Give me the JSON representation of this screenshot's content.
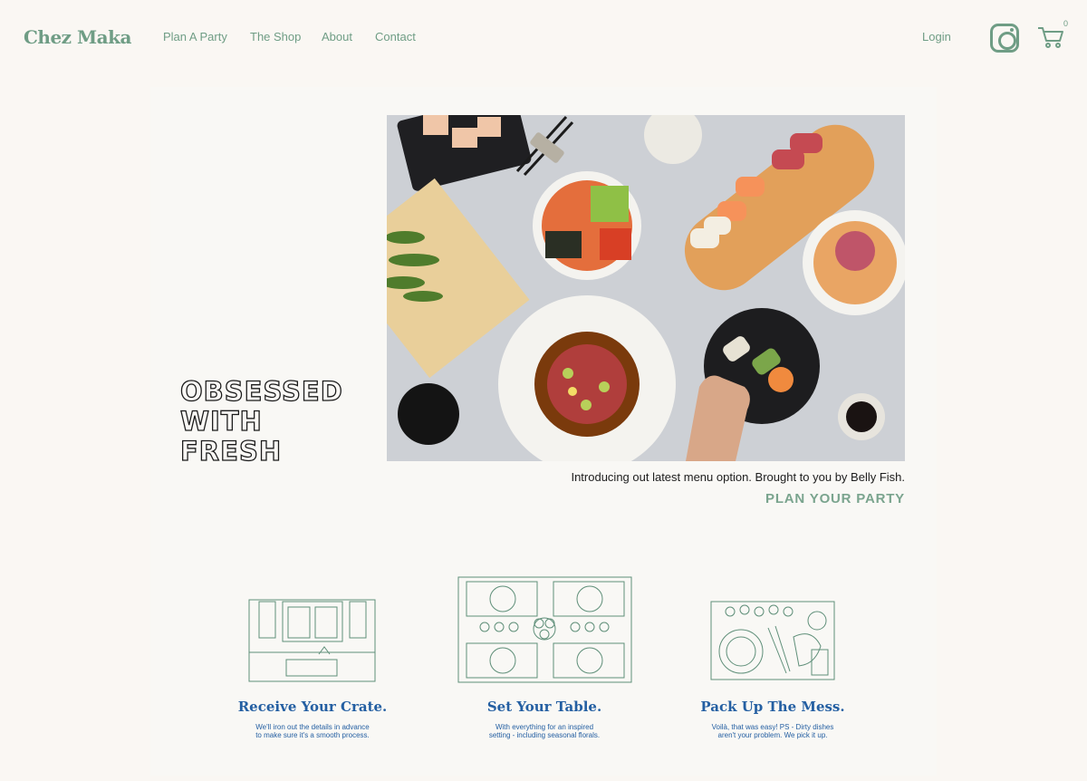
{
  "brand": {
    "name": "Chez Maka",
    "accent": "#6f9d85",
    "blue": "#245fa2"
  },
  "nav": {
    "links": [
      "Plan A Party",
      "The Shop",
      "About",
      "Contact"
    ],
    "login": "Login",
    "cart_count": "0",
    "icons": [
      "instagram-icon",
      "cart-icon"
    ]
  },
  "hero": {
    "title": "OBSESSED\nWITH\nFRESH",
    "caption": "Introducing out latest menu option. Brought to you by Belly Fish.",
    "cta": "PLAN YOUR PARTY"
  },
  "features": [
    {
      "title": "Receive Your Crate.",
      "text": "We'll iron out the details in advance\nto make sure it's a smooth process."
    },
    {
      "title": "Set Your Table.",
      "text": "With everything for an inspired\nsetting - including seasonal florals."
    },
    {
      "title": "Pack Up The Mess.",
      "text": "Voilà, that was easy! PS - Dirty dishes\naren't your problem. We pick it up."
    }
  ]
}
